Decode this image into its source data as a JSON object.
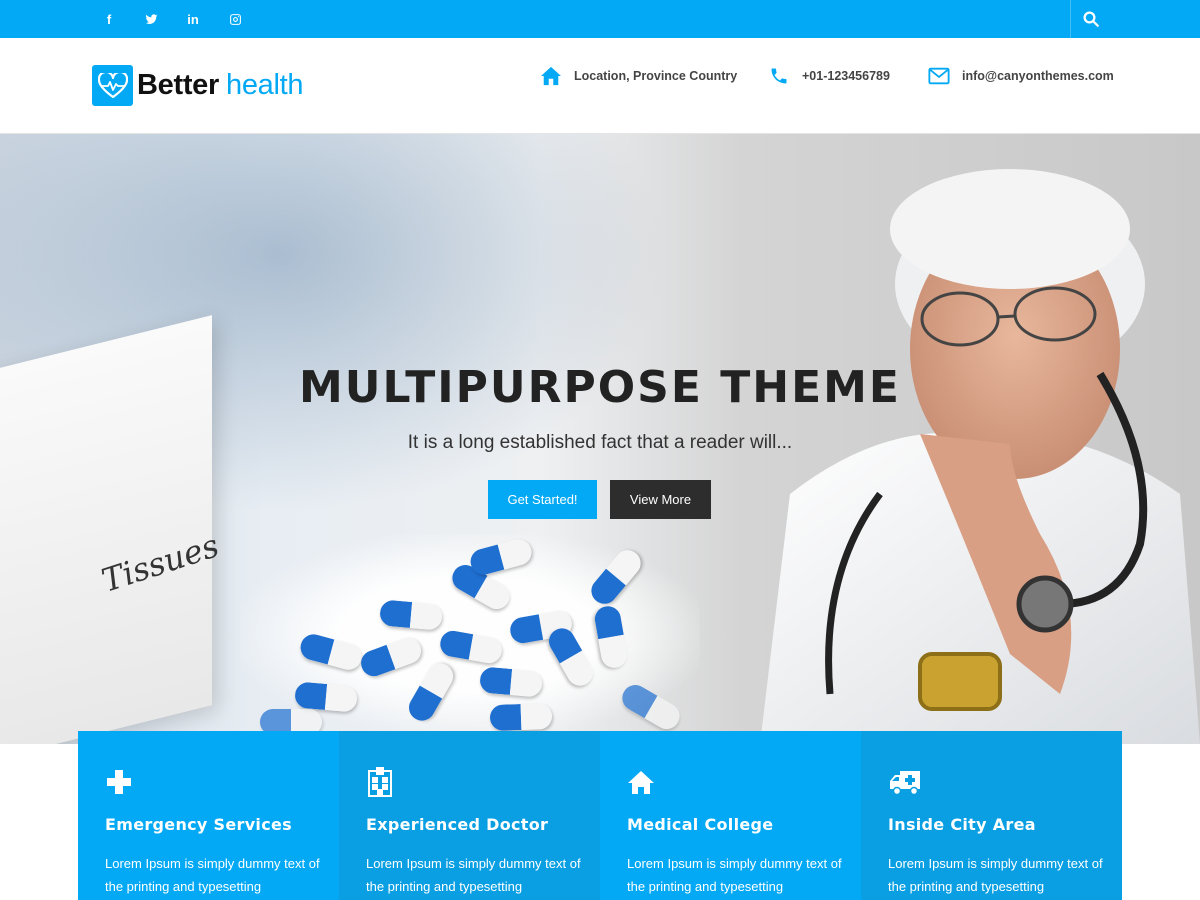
{
  "social": {
    "items": [
      {
        "icon": "facebook-icon",
        "label": "f"
      },
      {
        "icon": "twitter-icon",
        "label": ""
      },
      {
        "icon": "linkedin-icon",
        "label": "in"
      },
      {
        "icon": "instagram-icon",
        "label": ""
      }
    ]
  },
  "search": {
    "icon": "search-icon"
  },
  "brand": {
    "word1": "Better",
    "word2": "health",
    "icon": "heart-pulse-icon"
  },
  "contact": {
    "location": "Location, Province Country",
    "phone": "+01-123456789",
    "email": "info@canyonthemes.com"
  },
  "hero": {
    "title": "MULTIPURPOSE THEME",
    "subtitle": "It is a long established fact that a reader will...",
    "primary_button": "Get Started!",
    "secondary_button": "View More",
    "tissue_label": "Tissues"
  },
  "services": [
    {
      "icon": "plus-icon",
      "title": "Emergency Services",
      "text": "Lorem Ipsum is simply dummy text of the printing and typesetting"
    },
    {
      "icon": "hospital-icon",
      "title": "Experienced Doctor",
      "text": "Lorem Ipsum is simply dummy text of the printing and typesetting"
    },
    {
      "icon": "home-icon",
      "title": "Medical College",
      "text": "Lorem Ipsum is simply dummy text of the printing and typesetting"
    },
    {
      "icon": "ambulance-icon",
      "title": "Inside City Area",
      "text": "Lorem Ipsum is simply dummy text of the printing and typesetting"
    }
  ],
  "colors": {
    "accent": "#03a9f4",
    "dark_button": "#2d2d2d",
    "text_dark": "#222222"
  }
}
